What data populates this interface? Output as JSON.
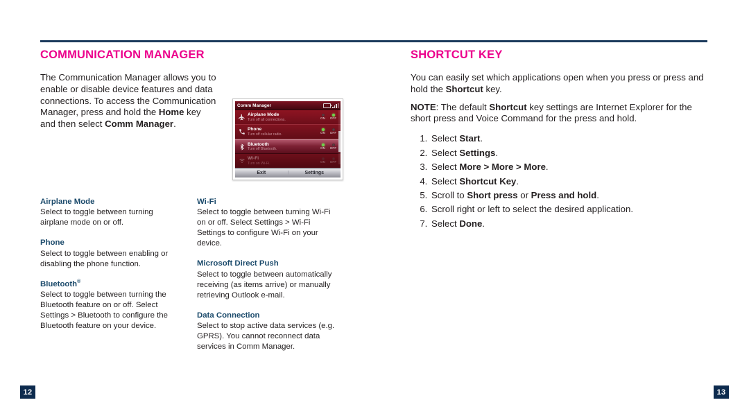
{
  "rule_color": "#1b3a5c",
  "accent_color": "#ec008c",
  "term_color": "#1b4a6b",
  "folio_color": "#0d2b4e",
  "left_page": {
    "title": "COMMUNICATION MANAGER",
    "intro_plain_1": "The Communication Manager allows you to enable or disable device features and data connections. To access the Communication Manager, press and hold the ",
    "intro_bold_1": "Home",
    "intro_plain_2": " key and then select ",
    "intro_bold_2": "Comm Manager",
    "intro_plain_3": ".",
    "folio": "12",
    "definitions_col1": [
      {
        "term": "Airplane Mode",
        "desc": "Select to toggle between turning airplane mode on or off."
      },
      {
        "term": "Phone",
        "desc": "Select to toggle between enabling or disabling the phone function."
      },
      {
        "term": "Bluetooth",
        "term_sup": "®",
        "desc": "Select to toggle between turning the Bluetooth feature on or off. Select Settings > Bluetooth to configure the Bluetooth feature on your device."
      }
    ],
    "definitions_col2": [
      {
        "term": "Wi-Fi",
        "desc": "Select to toggle between turning Wi-Fi on or off. Select Settings > Wi-Fi Settings to configure Wi-Fi on your device."
      },
      {
        "term": "Microsoft Direct Push",
        "desc": "Select to toggle between automatically receiving (as items arrive) or manually retrieving Outlook e-mail."
      },
      {
        "term": "Data Connection",
        "desc": "Select to stop active data services (e.g. GPRS). You cannot reconnect data services in Comm Manager."
      }
    ]
  },
  "device_screenshot": {
    "title": "Comm Manager",
    "status_icons": [
      "battery-icon",
      "signal-icon"
    ],
    "rows": [
      {
        "icon": "airplane-icon",
        "name": "Airplane Mode",
        "sub": "Turn off all connections.",
        "on_label": "ON",
        "off_label": "OFF",
        "state": "off",
        "selected": false,
        "dimmed": false
      },
      {
        "icon": "phone-icon",
        "name": "Phone",
        "sub": "Turn off cellular radio.",
        "on_label": "ON",
        "off_label": "OFF",
        "state": "on",
        "selected": false,
        "dimmed": false
      },
      {
        "icon": "bluetooth-icon",
        "name": "Bluetooth",
        "sub": "Turn off Bluetooth.",
        "on_label": "ON",
        "off_label": "OFF",
        "state": "on",
        "selected": true,
        "dimmed": false
      },
      {
        "icon": "wifi-icon",
        "name": "Wi-Fi",
        "sub": "Turn on Wi-Fi.",
        "on_label": "ON",
        "off_label": "OFF",
        "state": "off",
        "selected": false,
        "dimmed": true
      }
    ],
    "softkey_left": "Exit",
    "softkey_right": "Settings"
  },
  "right_page": {
    "title": "SHORTCUT KEY",
    "para1_a": "You can easily set which applications open when you press or press and hold the ",
    "para1_b": "Shortcut",
    "para1_c": " key.",
    "note_label": "NOTE",
    "note_a": ": The default ",
    "note_b": "Shortcut",
    "note_c": " key settings are Internet Explorer for the short press and Voice Command for the press and hold.",
    "folio": "13",
    "steps": [
      {
        "plain_before": "Select ",
        "bold": "Start",
        "plain_after": "."
      },
      {
        "plain_before": "Select ",
        "bold": "Settings",
        "plain_after": "."
      },
      {
        "plain_before": "Select ",
        "bold": "More > More > More",
        "plain_after": "."
      },
      {
        "plain_before": "Select ",
        "bold": "Shortcut Key",
        "plain_after": "."
      },
      {
        "plain_before": "Scroll to ",
        "bold": "Short press",
        "plain_mid": " or ",
        "bold2": "Press and hold",
        "plain_after": "."
      },
      {
        "plain_before": "Scroll right or left to select the desired application.",
        "bold": "",
        "plain_after": ""
      },
      {
        "plain_before": "Select ",
        "bold": "Done",
        "plain_after": "."
      }
    ]
  }
}
